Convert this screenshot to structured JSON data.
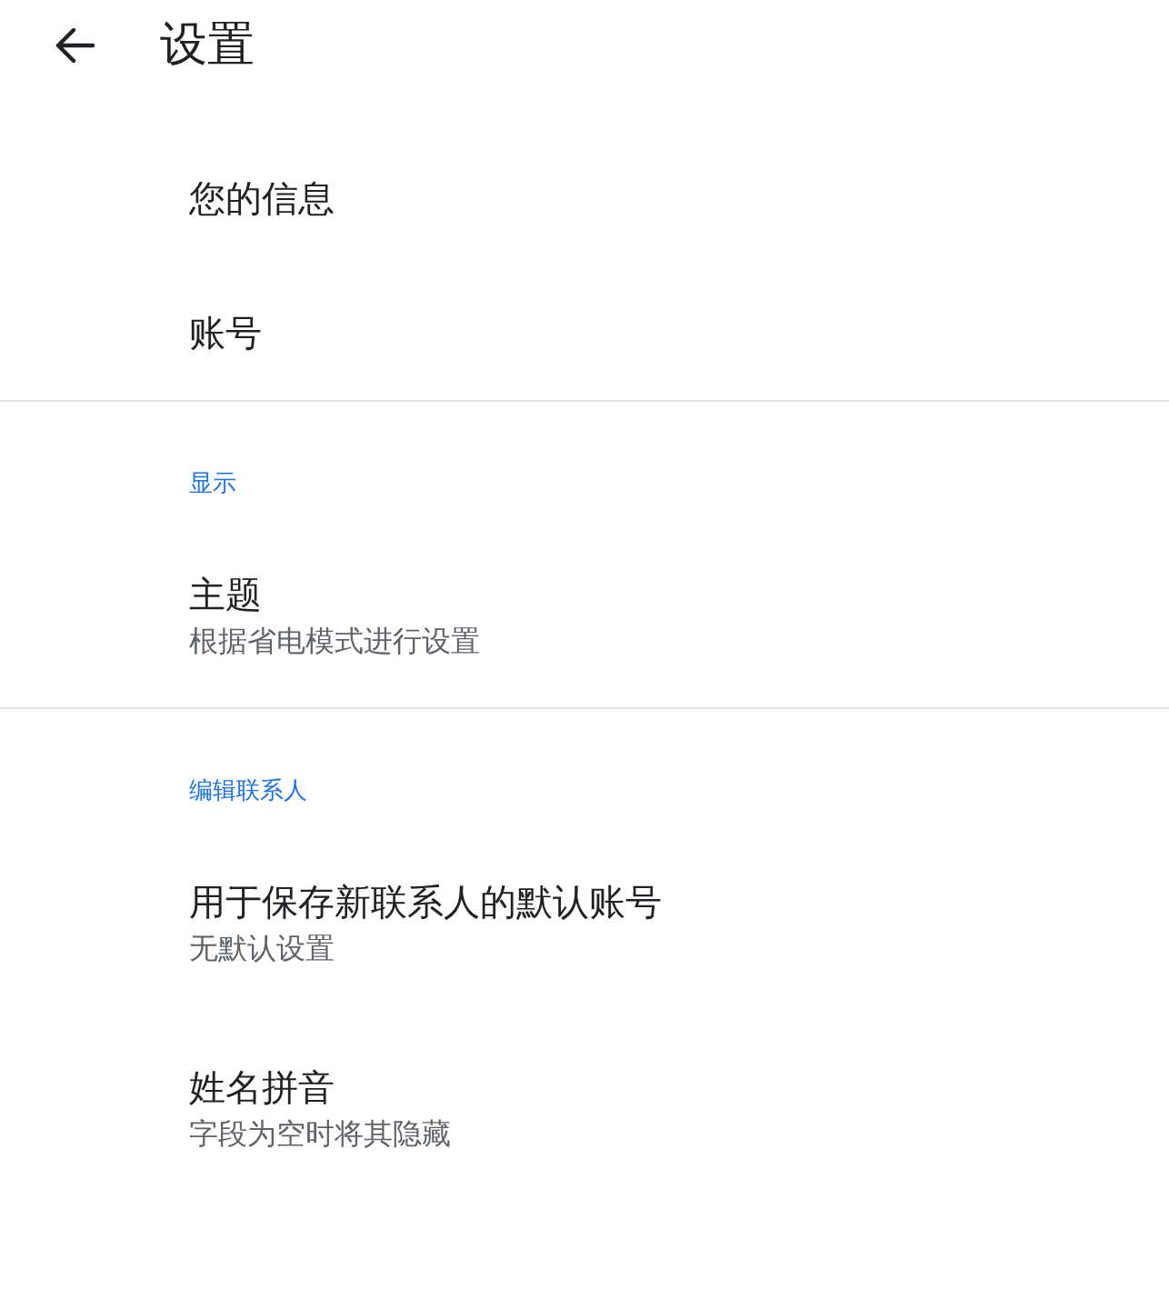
{
  "header": {
    "title": "设置"
  },
  "sections": [
    {
      "items": [
        {
          "title": "您的信息"
        },
        {
          "title": "账号"
        }
      ]
    },
    {
      "heading": "显示",
      "items": [
        {
          "title": "主题",
          "subtitle": "根据省电模式进行设置"
        }
      ]
    },
    {
      "heading": "编辑联系人",
      "items": [
        {
          "title": "用于保存新联系人的默认账号",
          "subtitle": "无默认设置"
        },
        {
          "title": "姓名拼音",
          "subtitle": "字段为空时将其隐藏"
        }
      ]
    }
  ]
}
